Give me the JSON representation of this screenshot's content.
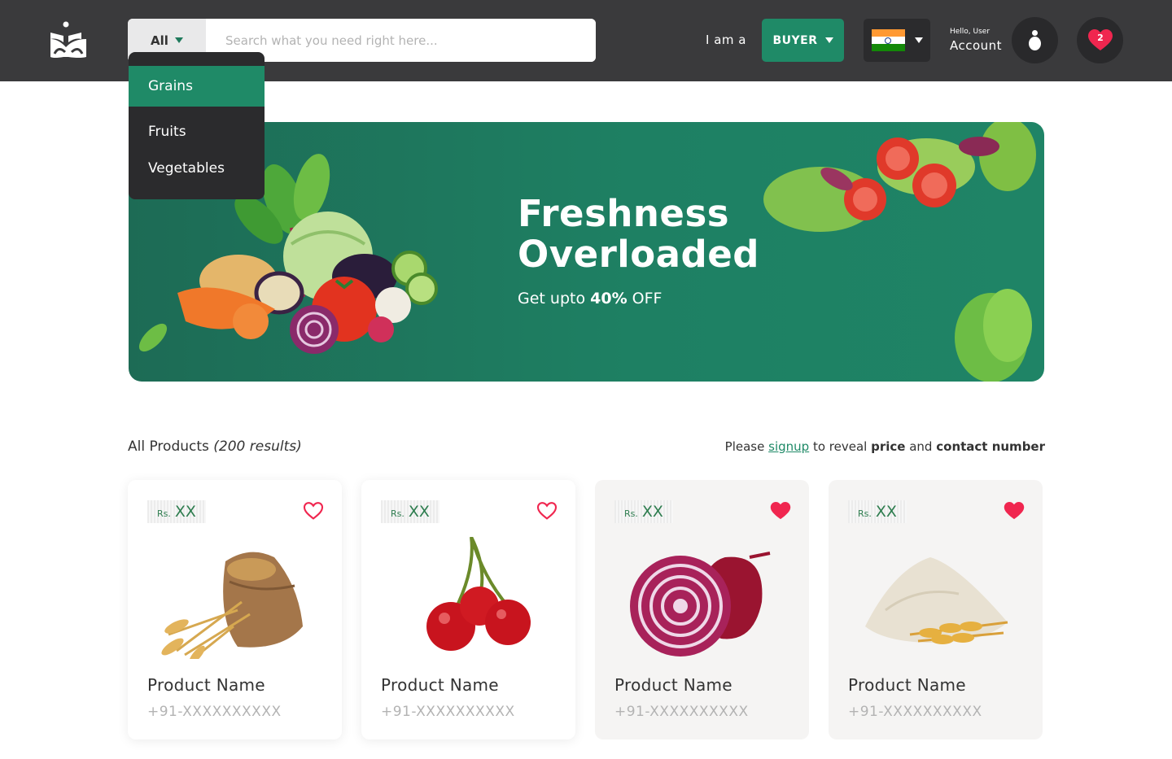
{
  "header": {
    "search": {
      "category_label": "All",
      "placeholder": "Search what you need right here..."
    },
    "role_prompt": "I am a",
    "role_value": "BUYER",
    "account": {
      "greeting": "Hello, User",
      "label": "Account"
    },
    "wishlist_count": "2"
  },
  "dropdown": {
    "items": [
      {
        "label": "Grains",
        "active": true
      },
      {
        "label": "Fruits",
        "active": false
      },
      {
        "label": "Vegetables",
        "active": false
      }
    ]
  },
  "banner": {
    "title_line1": "Freshness",
    "title_line2": "Overloaded",
    "sub_prefix": "Get upto",
    "sub_bold": "40%",
    "sub_suffix": "OFF"
  },
  "results": {
    "label": "All Products",
    "count": "(200 results)"
  },
  "signup_note": {
    "prefix": "Please",
    "link": "signup",
    "middle": "to reveal",
    "bold1": "price",
    "and": "and",
    "bold2": "contact number"
  },
  "products": [
    {
      "currency": "Rs.",
      "price": "XX",
      "name": "Product Name",
      "phone": "+91-XXXXXXXXXX",
      "liked": false,
      "image": "wheat-sack"
    },
    {
      "currency": "Rs.",
      "price": "XX",
      "name": "Product Name",
      "phone": "+91-XXXXXXXXXX",
      "liked": false,
      "image": "cherries"
    },
    {
      "currency": "Rs.",
      "price": "XX",
      "name": "Product Name",
      "phone": "+91-XXXXXXXXXX",
      "liked": true,
      "image": "red-onion"
    },
    {
      "currency": "Rs.",
      "price": "XX",
      "name": "Product Name",
      "phone": "+91-XXXXXXXXXX",
      "liked": true,
      "image": "flour"
    }
  ],
  "colors": {
    "header_bg": "#3a3a3c",
    "accent_green": "#1f8a67",
    "heart_red": "#f0264f",
    "price_green": "#2e7d4f"
  }
}
